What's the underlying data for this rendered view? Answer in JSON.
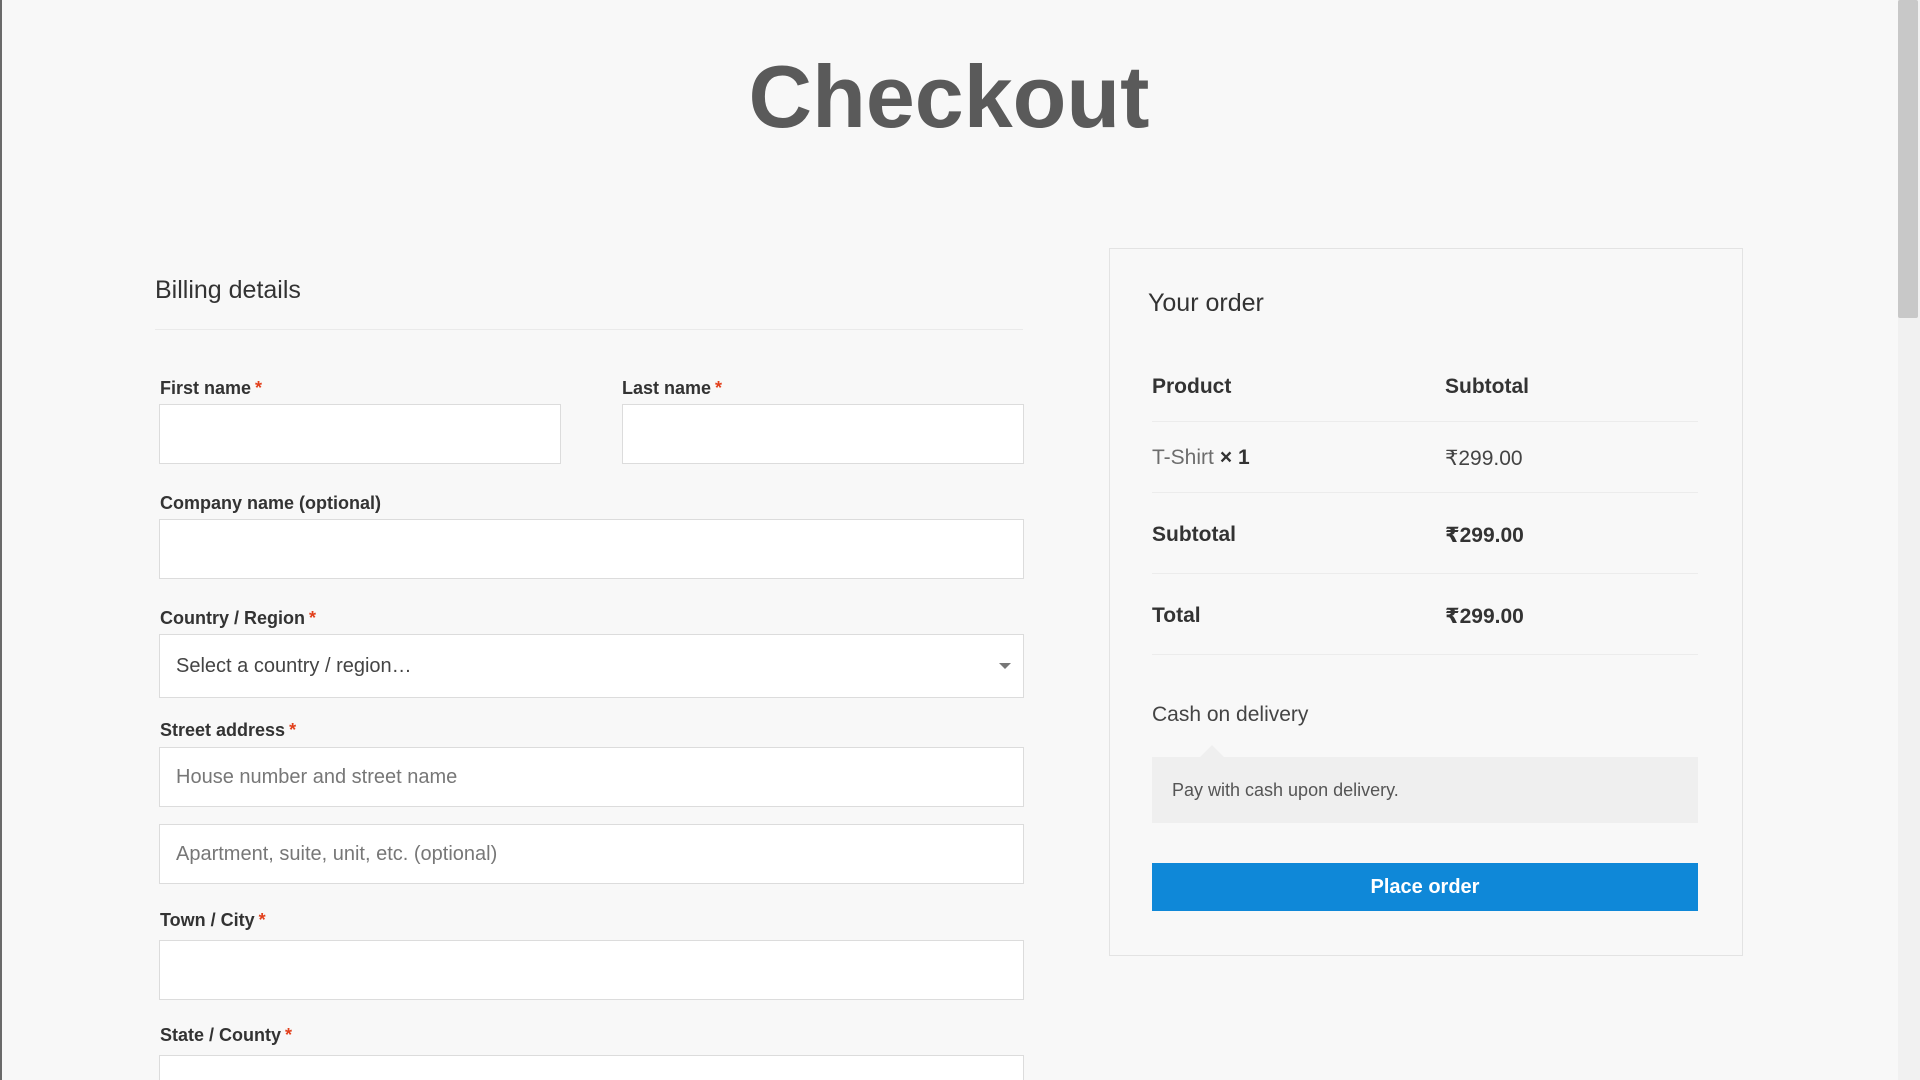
{
  "page": {
    "title": "Checkout"
  },
  "billing": {
    "heading": "Billing details",
    "required_mark": "*",
    "first_name": {
      "label": "First name",
      "value": ""
    },
    "last_name": {
      "label": "Last name",
      "value": ""
    },
    "company": {
      "label": "Company name (optional)",
      "value": ""
    },
    "country": {
      "label": "Country / Region",
      "selected": "Select a country / region…"
    },
    "street": {
      "label": "Street address",
      "line1_placeholder": "House number and street name",
      "line2_placeholder": "Apartment, suite, unit, etc. (optional)"
    },
    "city": {
      "label": "Town / City",
      "value": ""
    },
    "state": {
      "label": "State / County",
      "value": ""
    }
  },
  "order": {
    "heading": "Your order",
    "col_product": "Product",
    "col_subtotal": "Subtotal",
    "item": {
      "name": "T-Shirt",
      "qty": "× 1",
      "price": "₹299.00"
    },
    "subtotal_label": "Subtotal",
    "subtotal_value": "₹299.00",
    "total_label": "Total",
    "total_value": "₹299.00",
    "payment_method": "Cash on delivery",
    "payment_description": "Pay with cash upon delivery.",
    "place_order_label": "Place order"
  },
  "colors": {
    "accent": "#0f88d8",
    "required": "#e2401c",
    "background": "#f8f8f8"
  }
}
